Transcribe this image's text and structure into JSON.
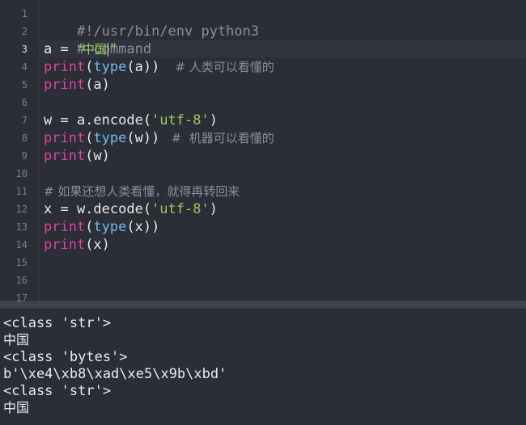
{
  "editor": {
    "active_line": "3",
    "line_numbers": [
      "1",
      "2",
      "3",
      "4",
      "5",
      "6",
      "7",
      "8",
      "9",
      "10",
      "11",
      "12",
      "13",
      "14",
      "15",
      "16",
      "17"
    ],
    "code": {
      "l1": "#!/usr/bin/env python3",
      "l2": "# command",
      "l3_a": "a = ",
      "l3_str": "\"中国",
      "l3_str_end": "\"",
      "l4_print": "print",
      "l4_open": "(",
      "l4_type": "type",
      "l4_args": "(a))",
      "l4_comment": "    # 人类可以看懂的",
      "l5_print": "print",
      "l5_args": "(a)",
      "l7_a": "w = a.encode(",
      "l7_str": "'utf-8'",
      "l7_close": ")",
      "l8_print": "print",
      "l8_open": "(",
      "l8_type": "type",
      "l8_args": "(w))",
      "l8_comment": "   #  机器可以看懂的",
      "l9_print": "print",
      "l9_args": "(w)",
      "l11_comment": "# 如果还想人类看懂，就得再转回来",
      "l12_a": "x = w.decode(",
      "l12_str": "'utf-8'",
      "l12_close": ")",
      "l13_print": "print",
      "l13_open": "(",
      "l13_type": "type",
      "l13_args": "(x))",
      "l14_print": "print",
      "l14_args": "(x)"
    },
    "colors": {
      "background": "#2b2d37",
      "keyword": "#d7469a",
      "builtin": "#6bc0e6",
      "string": "#9ac95c",
      "comment": "#8a8f9c"
    }
  },
  "output": {
    "lines": [
      "<class 'str'>",
      "中国",
      "<class 'bytes'>",
      "b'\\xe4\\xb8\\xad\\xe5\\x9b\\xbd'",
      "<class 'str'>",
      "中国"
    ]
  }
}
